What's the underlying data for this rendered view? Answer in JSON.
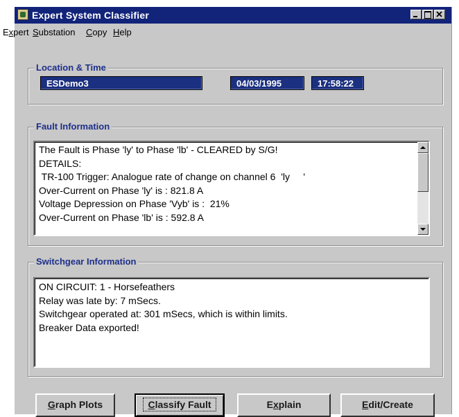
{
  "window": {
    "title": "Expert System Classifier"
  },
  "menu": [
    {
      "pre": "E",
      "u": "x",
      "post": "pert"
    },
    {
      "pre": "",
      "u": "S",
      "post": "ubstation"
    },
    {
      "pre": "",
      "u": "C",
      "post": "opy"
    },
    {
      "pre": "",
      "u": "H",
      "post": "elp"
    }
  ],
  "location": {
    "label": "Location & Time",
    "site": "ESDemo3",
    "date": "04/03/1995",
    "time": "17:58:22"
  },
  "fault": {
    "label": "Fault Information",
    "lines": [
      "The Fault is Phase 'ly' to Phase 'lb' - CLEARED by S/G!",
      "DETAILS:",
      " TR-100 Trigger: Analogue rate of change on channel 6  'ly     '",
      "Over-Current on Phase 'ly' is : 821.8 A",
      "Voltage Depression on Phase 'Vyb' is :  21%",
      "Over-Current on Phase 'lb' is : 592.8 A"
    ]
  },
  "switchgear": {
    "label": "Switchgear Information",
    "lines": [
      "ON CIRCUIT: 1 - Horsefeathers",
      "Relay was late by: 7 mSecs.",
      "Switchgear operated at: 301 mSecs, which is within limits.",
      "Breaker Data exported!"
    ]
  },
  "buttons": [
    {
      "pre": "",
      "u": "G",
      "post": "raph Plots"
    },
    {
      "pre": "",
      "u": "C",
      "post": "lassify Fault"
    },
    {
      "pre": "E",
      "u": "x",
      "post": "plain"
    },
    {
      "pre": "",
      "u": "E",
      "post": "dit/Create"
    }
  ]
}
